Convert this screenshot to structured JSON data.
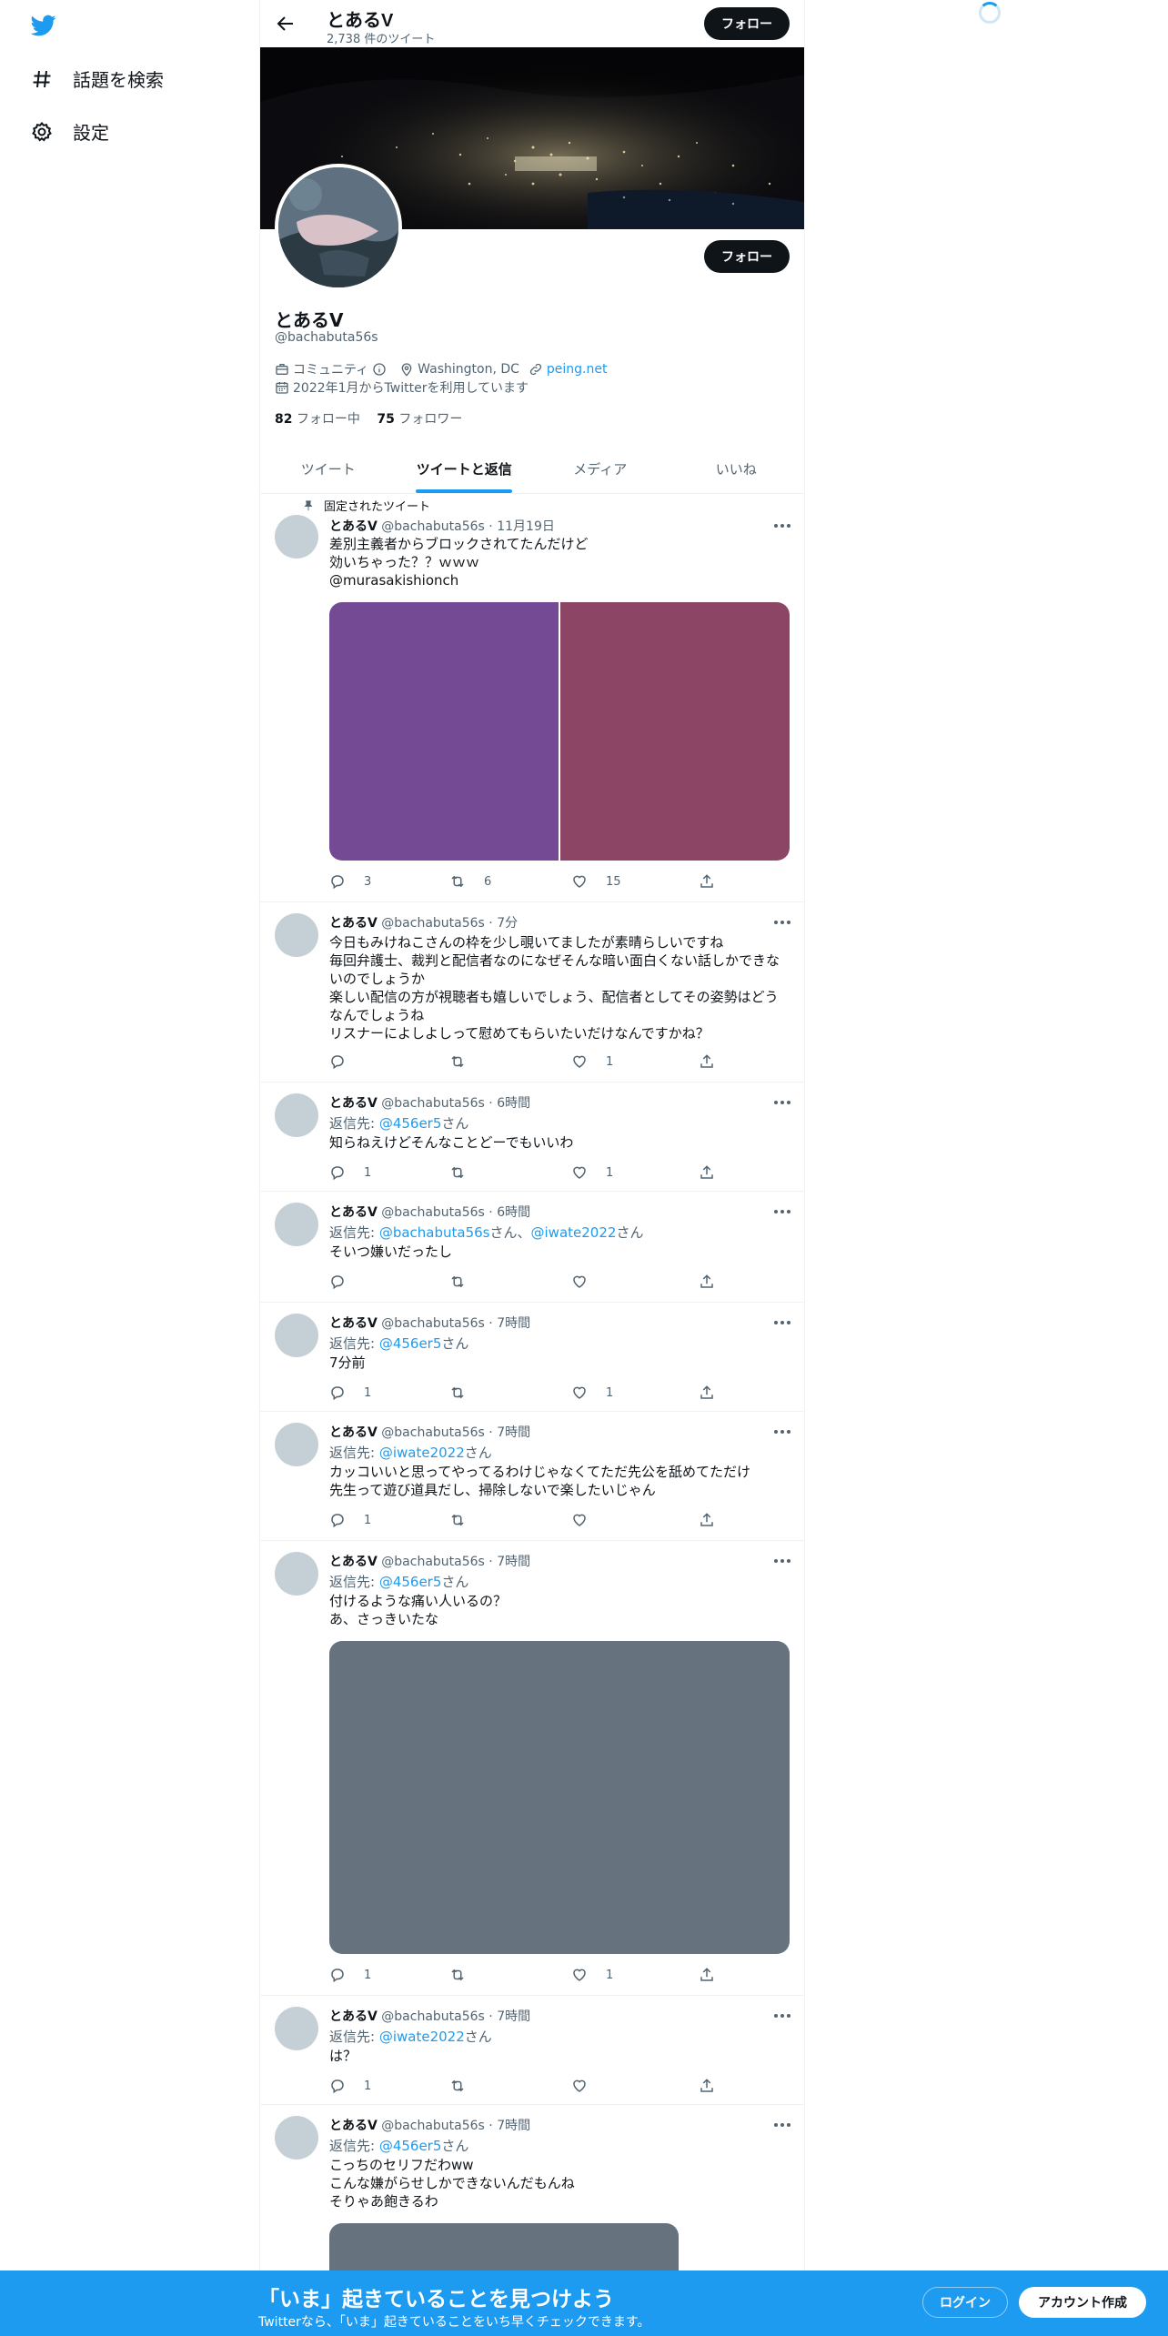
{
  "nav": {
    "explore_label": "話題を検索",
    "settings_label": "設定"
  },
  "header": {
    "name": "とあるV",
    "tweet_count": "2,738 件のツイート",
    "follow_label": "フォロー"
  },
  "profile": {
    "name": "とあるV",
    "handle": "@bachabuta56s",
    "follow_label": "フォロー",
    "category": "コミュニティ",
    "location": "Washington, DC",
    "website": "peing.net",
    "joined": "2022年1月からTwitterを利用しています",
    "following_count": "82",
    "following_label": "フォロー中",
    "followers_count": "75",
    "followers_label": "フォロワー"
  },
  "tabs": [
    {
      "label": "ツイート"
    },
    {
      "label": "ツイートと返信"
    },
    {
      "label": "メディア"
    },
    {
      "label": "いいね"
    }
  ],
  "pinned_label": "固定されたツイート",
  "tweets": [
    {
      "name": "とあるV",
      "handle": "@bachabuta56s",
      "time": "11月19日",
      "lines": [
        "差別主義者からブロックされてたんだけど",
        "効いちゃった？？ｗｗｗ"
      ],
      "mention_line": "@murasakishionch",
      "replies": "3",
      "retweets": "6",
      "likes": "15"
    },
    {
      "name": "とあるV",
      "handle": "@bachabuta56s",
      "time": "7分",
      "lines": [
        "今日もみけねこさんの枠を少し覗いてましたが素晴らしいですね",
        "毎回弁護士、裁判と配信者なのになぜそんな暗い面白くない話しかできな",
        "いのでしょうか",
        "楽しい配信の方が視聴者も嬉しいでしょう、配信者としてその姿勢はどう",
        "なんでしょうね",
        "リスナーによしよしって慰めてもらいたいだけなんですかね？"
      ],
      "replies": "",
      "retweets": "",
      "likes": "1"
    },
    {
      "name": "とあるV",
      "handle": "@bachabuta56s",
      "time": "6時間",
      "reply_prefix": "返信先: ",
      "reply_to": "@456er5",
      "reply_suffix": "さん",
      "lines": [
        "知らねえけどそんなことどーでもいいわ"
      ],
      "replies": "1",
      "retweets": "",
      "likes": "1"
    },
    {
      "name": "とあるV",
      "handle": "@bachabuta56s",
      "time": "6時間",
      "reply_prefix": "返信先: ",
      "reply_to": "@bachabuta56s",
      "reply_mid": "さん、",
      "reply_to2": "@iwate2022",
      "reply_suffix": "さん",
      "lines": [
        "そいつ嫌いだったし"
      ],
      "replies": "",
      "retweets": "",
      "likes": ""
    },
    {
      "name": "とあるV",
      "handle": "@bachabuta56s",
      "time": "7時間",
      "reply_prefix": "返信先: ",
      "reply_to": "@456er5",
      "reply_suffix": "さん",
      "lines": [
        "7分前"
      ],
      "replies": "1",
      "retweets": "",
      "likes": "1"
    },
    {
      "name": "とあるV",
      "handle": "@bachabuta56s",
      "time": "7時間",
      "reply_prefix": "返信先: ",
      "reply_to": "@iwate2022",
      "reply_suffix": "さん",
      "lines": [
        "カッコいいと思ってやってるわけじゃなくてただ先公を舐めてただけ",
        "先生って遊び道具だし、掃除しないで楽したいじゃん"
      ],
      "replies": "1",
      "retweets": "",
      "likes": ""
    },
    {
      "name": "とあるV",
      "handle": "@bachabuta56s",
      "time": "7時間",
      "reply_prefix": "返信先: ",
      "reply_to": "@456er5",
      "reply_suffix": "さん",
      "lines": [
        "付けるような痛い人いるの？",
        "あ、さっきいたな"
      ],
      "replies": "1",
      "retweets": "",
      "likes": "1"
    },
    {
      "name": "とあるV",
      "handle": "@bachabuta56s",
      "time": "7時間",
      "reply_prefix": "返信先: ",
      "reply_to": "@iwate2022",
      "reply_suffix": "さん",
      "lines": [
        "は？"
      ],
      "replies": "1",
      "retweets": "",
      "likes": ""
    },
    {
      "name": "とあるV",
      "handle": "@bachabuta56s",
      "time": "7時間",
      "reply_prefix": "返信先: ",
      "reply_to": "@456er5",
      "reply_suffix": "さん",
      "lines": [
        "こっちのセリフだわww",
        "こんな嫌がらせしかできないんだもんね",
        "そりゃあ飽きるわ"
      ],
      "replies": "",
      "retweets": "",
      "likes": ""
    }
  ],
  "colors": {
    "accent": "#1d9bf0",
    "media_purple": "#744a94",
    "media_maroon": "#8c4565",
    "media_gray": "#66737f"
  },
  "bottom": {
    "title": "「いま」起きていることを見つけよう",
    "subtitle": "Twitterなら、「いま」起きていることをいち早くチェックできます。",
    "login_label": "ログイン",
    "signup_label": "アカウント作成"
  }
}
